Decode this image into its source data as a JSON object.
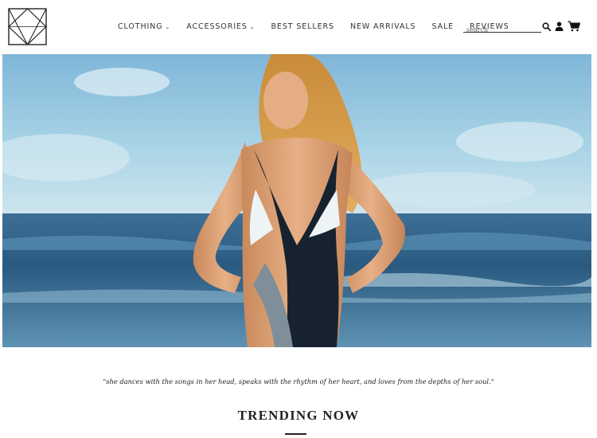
{
  "header": {
    "logo_icon": "geometric-diamond-logo",
    "nav": [
      {
        "label": "CLOTHING",
        "dropdown": true
      },
      {
        "label": "ACCESSORIES",
        "dropdown": true
      },
      {
        "label": "BEST SELLERS",
        "dropdown": false
      },
      {
        "label": "NEW ARRIVALS",
        "dropdown": false
      },
      {
        "label": "SALE",
        "dropdown": false
      },
      {
        "label": "REVIEWS",
        "dropdown": false
      }
    ],
    "search": {
      "placeholder": "search",
      "value": ""
    },
    "icons": [
      "search-icon",
      "user-icon",
      "cart-icon"
    ]
  },
  "hero": {
    "image": "woman in black-and-white swimsuit standing in front of ocean waves"
  },
  "quote": "\"she dances with the songs in her head, speaks with the rhythm of her heart, and loves from the depths of her soul.\"",
  "section": {
    "title": "TRENDING NOW"
  },
  "colors": {
    "text": "#222222",
    "accent_line": "#222222",
    "sky": "#8fc3df",
    "sea": "#2f5f86"
  }
}
